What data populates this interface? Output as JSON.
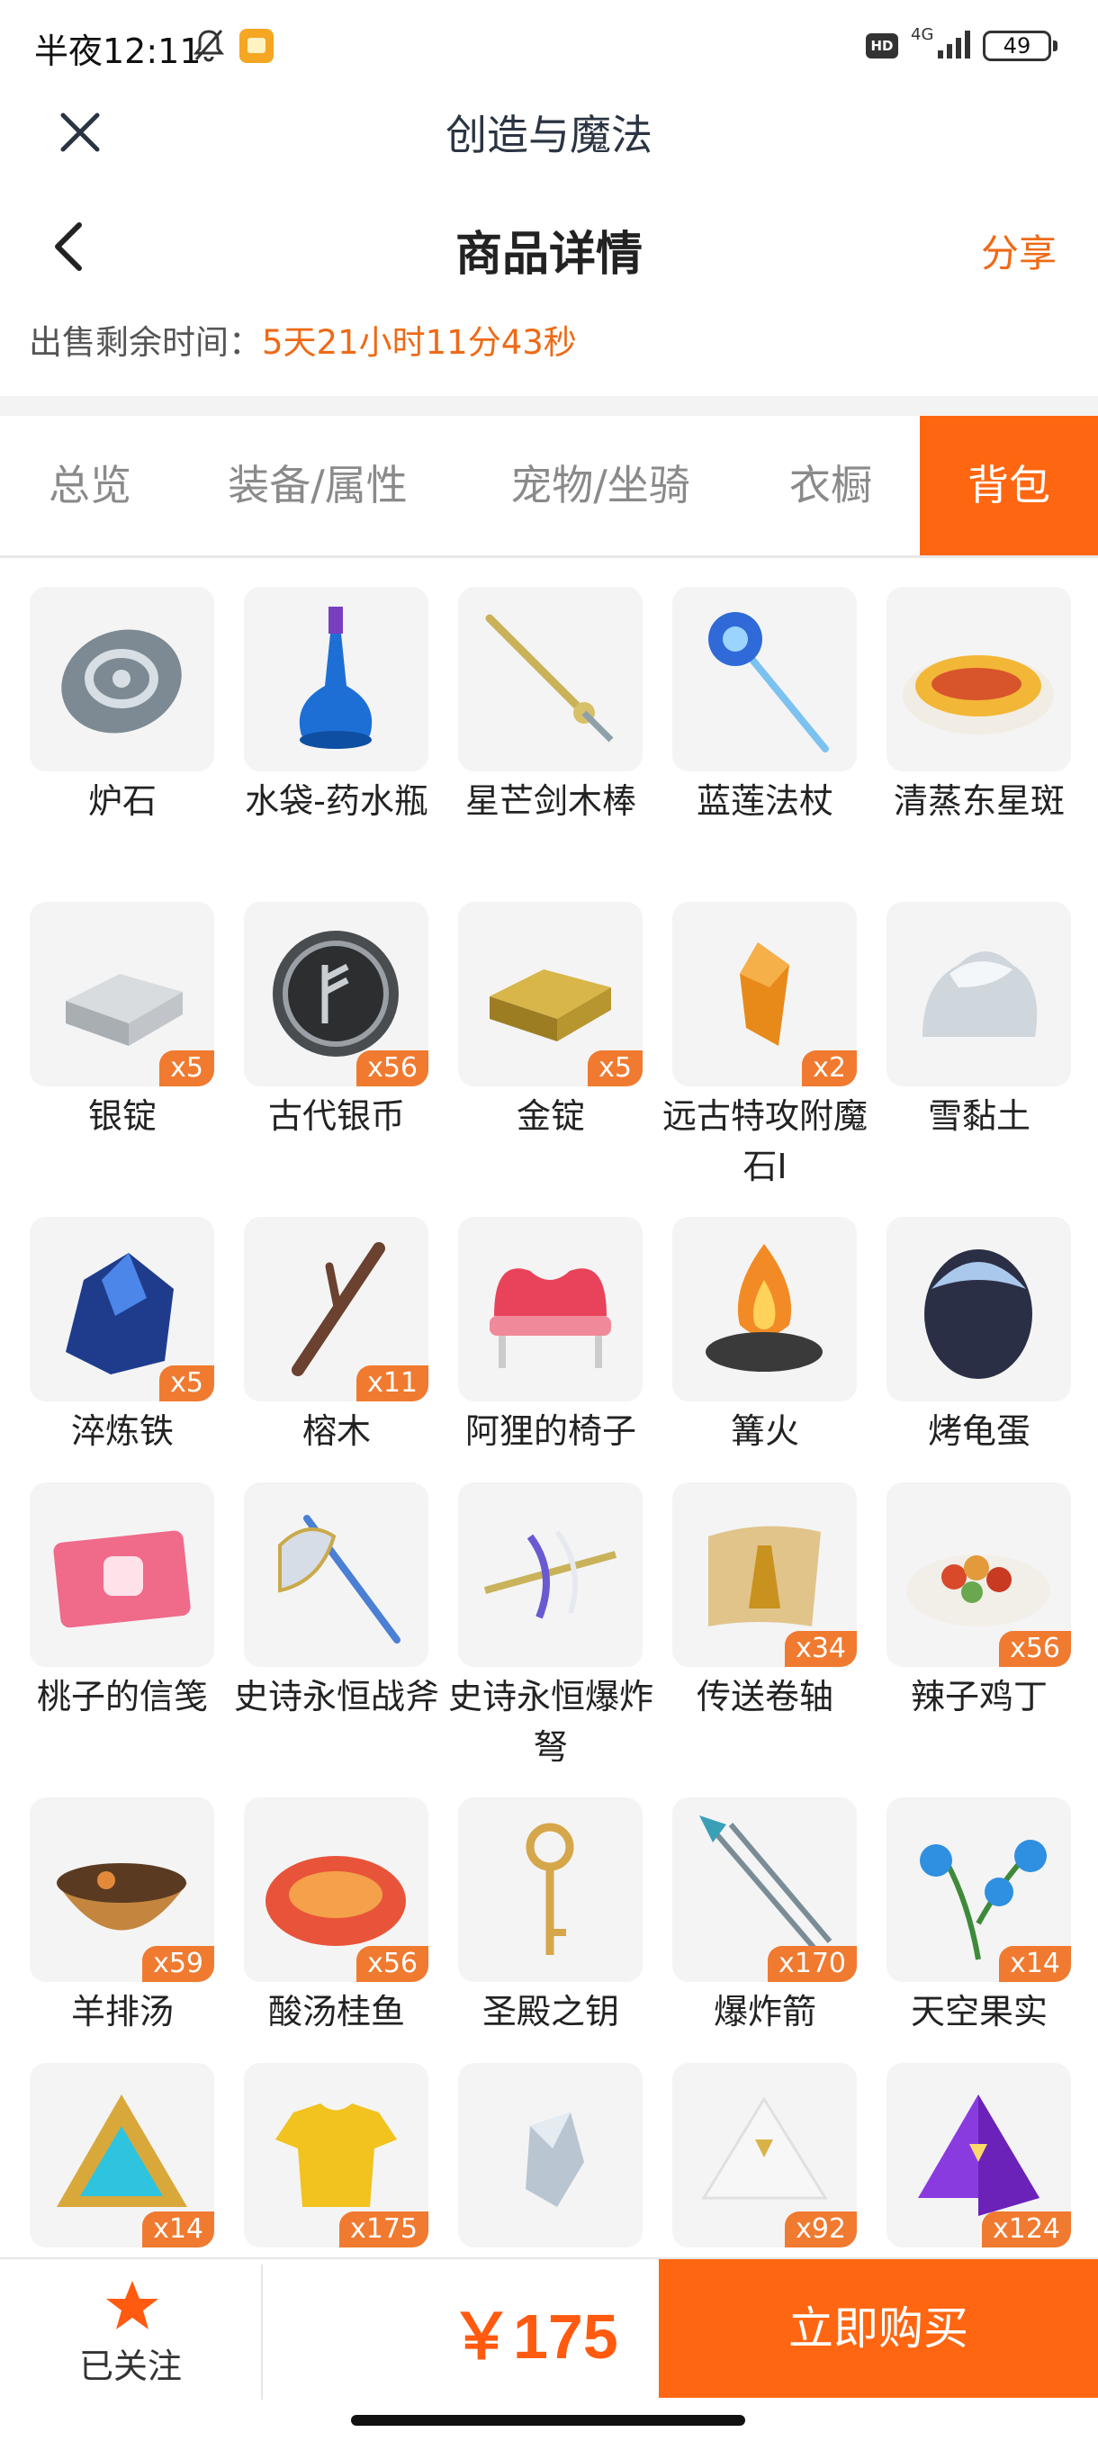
{
  "status": {
    "time": "半夜12:11",
    "hd": "HD",
    "network": "4G",
    "battery": "49"
  },
  "app": {
    "title": "创造与魔法"
  },
  "header": {
    "title": "商品详情",
    "share": "分享"
  },
  "countdown": {
    "label": "出售剩余时间：",
    "value": "5天21小时11分43秒"
  },
  "tabs": [
    {
      "label": "总览",
      "active": false
    },
    {
      "label": "装备/属性",
      "active": false
    },
    {
      "label": "宠物/坐骑",
      "active": false
    },
    {
      "label": "衣橱",
      "active": false
    },
    {
      "label": "背包",
      "active": true
    }
  ],
  "items": [
    {
      "name": "炉石",
      "count": "",
      "icon": "hearthstone-icon"
    },
    {
      "name": "水袋-药水瓶",
      "count": "",
      "icon": "potion-bottle-icon"
    },
    {
      "name": "星芒剑木棒",
      "count": "",
      "icon": "sword-icon"
    },
    {
      "name": "蓝莲法杖",
      "count": "",
      "icon": "lotus-staff-icon"
    },
    {
      "name": "清蒸东星斑",
      "count": "",
      "icon": "steamed-fish-icon"
    },
    {
      "name": "银锭",
      "count": "x5",
      "icon": "silver-ingot-icon"
    },
    {
      "name": "古代银币",
      "count": "x56",
      "icon": "ancient-coin-icon"
    },
    {
      "name": "金锭",
      "count": "x5",
      "icon": "gold-ingot-icon"
    },
    {
      "name": "远古特攻附魔石Ⅰ",
      "count": "x2",
      "icon": "enchant-stone-icon"
    },
    {
      "name": "雪黏土",
      "count": "",
      "icon": "snow-clay-icon"
    },
    {
      "name": "淬炼铁",
      "count": "x5",
      "icon": "tempered-iron-icon"
    },
    {
      "name": "榕木",
      "count": "x11",
      "icon": "banyan-wood-icon"
    },
    {
      "name": "阿狸的椅子",
      "count": "",
      "icon": "ahri-chair-icon"
    },
    {
      "name": "篝火",
      "count": "",
      "icon": "campfire-icon"
    },
    {
      "name": "烤龟蛋",
      "count": "",
      "icon": "turtle-egg-icon"
    },
    {
      "name": "桃子的信笺",
      "count": "",
      "icon": "letter-icon"
    },
    {
      "name": "史诗永恒战斧",
      "count": "",
      "icon": "battle-axe-icon"
    },
    {
      "name": "史诗永恒爆炸弩",
      "count": "",
      "icon": "crossbow-icon"
    },
    {
      "name": "传送卷轴",
      "count": "x34",
      "icon": "scroll-icon"
    },
    {
      "name": "辣子鸡丁",
      "count": "x56",
      "icon": "spicy-chicken-icon"
    },
    {
      "name": "羊排汤",
      "count": "x59",
      "icon": "lamb-soup-icon"
    },
    {
      "name": "酸汤桂鱼",
      "count": "x56",
      "icon": "sour-fish-icon"
    },
    {
      "name": "圣殿之钥",
      "count": "",
      "icon": "temple-key-icon"
    },
    {
      "name": "爆炸箭",
      "count": "x170",
      "icon": "explosive-arrow-icon"
    },
    {
      "name": "天空果实",
      "count": "x14",
      "icon": "sky-fruit-icon"
    },
    {
      "name": "",
      "count": "x14",
      "icon": "triangle-rune-icon"
    },
    {
      "name": "",
      "count": "x175",
      "icon": "yellow-shirt-icon"
    },
    {
      "name": "",
      "count": "",
      "icon": "crystal-shard-icon"
    },
    {
      "name": "",
      "count": "x92",
      "icon": "white-pyramid-icon"
    },
    {
      "name": "",
      "count": "x124",
      "icon": "purple-pyramid-icon"
    }
  ],
  "bottom": {
    "follow_label": "已关注",
    "price": "￥175",
    "buy_label": "立即购买"
  },
  "colors": {
    "accent": "#ff6611",
    "price": "#ff5a10",
    "countdown": "#ee6a16"
  }
}
